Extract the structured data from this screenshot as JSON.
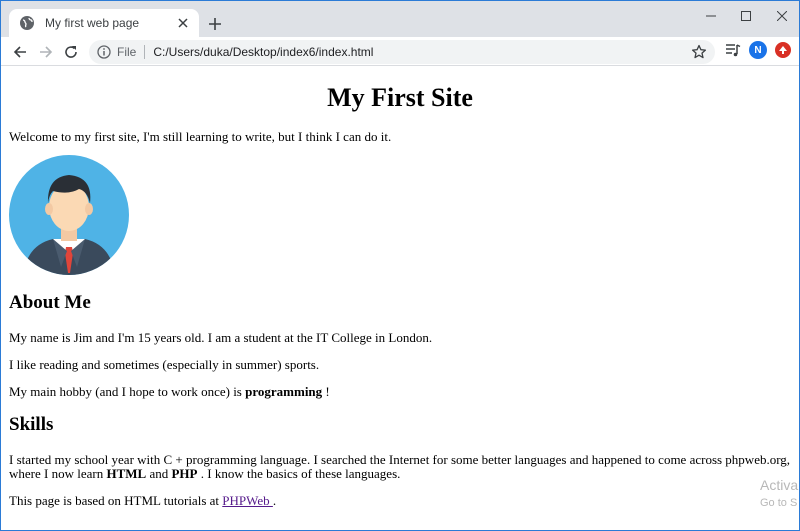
{
  "browser": {
    "tab_title": "My first web page",
    "new_tab_symbol": "+",
    "file_label": "File",
    "url": "C:/Users/duka/Desktop/index6/index.html",
    "profile_initial": "N"
  },
  "page": {
    "heading": "My First Site",
    "intro": "Welcome to my first site, I'm still learning to write, but I think I can do it.",
    "about": {
      "heading": "About Me",
      "line1": "My name is Jim and I'm 15 years old. I am a student at the IT College in London.",
      "line2": "I like reading and sometimes (especially in summer) sports.",
      "line3_pre": "My main hobby (and I hope to work once) is ",
      "line3_bold": "programming",
      "line3_post": " !"
    },
    "skills": {
      "heading": "Skills",
      "para1_line1": "I started my school year with C + programming language. I searched the Internet for some better languages and happened to come across phpweb.org,",
      "para1_line2_pre": "where I now learn ",
      "para1_html": "HTML",
      "para1_and": " and ",
      "para1_php": "PHP",
      "para1_line2_post": " . I know the basics of these languages.",
      "para2_pre": "This page is based on HTML tutorials at ",
      "para2_link": "PHPWeb ",
      "para2_post": "."
    }
  },
  "watermark": {
    "line1": "Activa",
    "line2": "Go to S"
  },
  "colors": {
    "chrome_bg": "#dee1e6",
    "link": "#551a8b",
    "avatar_bg": "#1a73e8",
    "profile_circle": "#4fb3e6"
  }
}
